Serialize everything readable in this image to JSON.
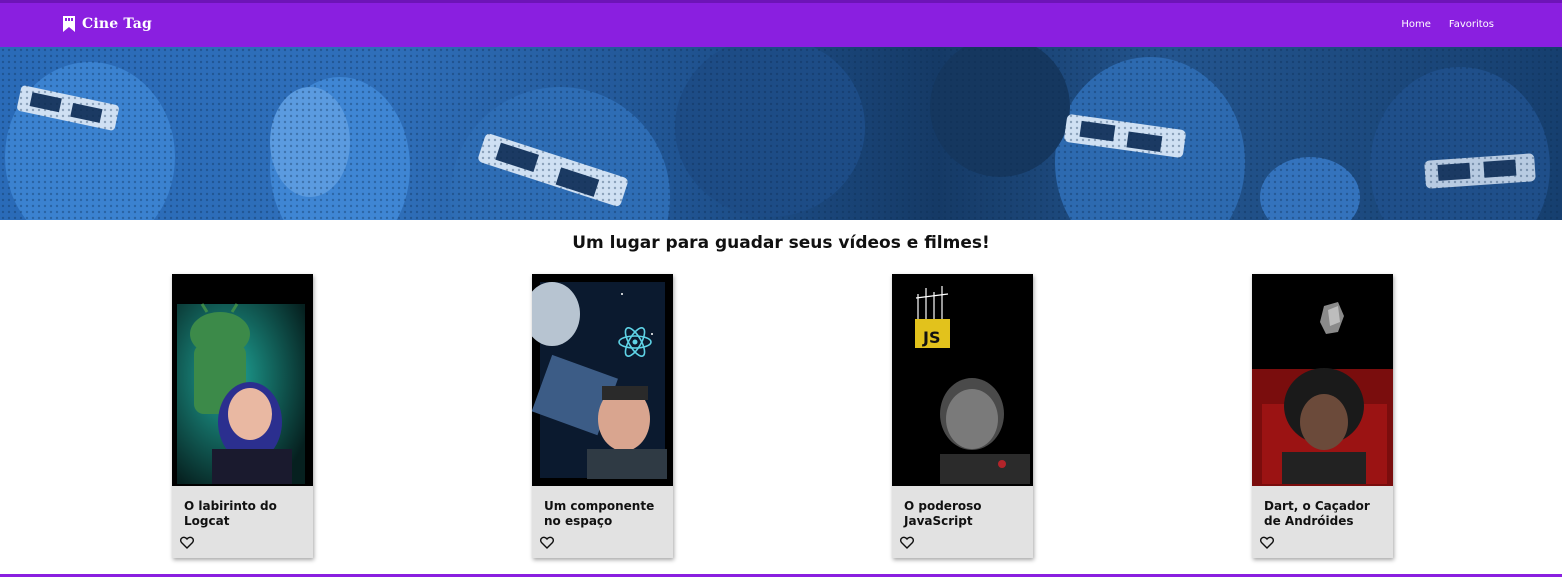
{
  "header": {
    "brand": "Cine Tag",
    "brand_icon": "bookmark-clapper-icon",
    "nav": [
      {
        "label": "Home"
      },
      {
        "label": "Favoritos"
      }
    ]
  },
  "banner": {
    "icon": "cinema-audience-3d-glasses-image"
  },
  "main": {
    "tagline": "Um lugar para guadar seus vídeos e filmes!",
    "cards": [
      {
        "title": "O labirinto do Logcat",
        "favorite_icon": "heart-outline-icon"
      },
      {
        "title": "Um componente no espaço",
        "favorite_icon": "heart-outline-icon"
      },
      {
        "title": "O poderoso JavaScript",
        "favorite_icon": "heart-outline-icon"
      },
      {
        "title": "Dart, o Caçador de Andróides",
        "favorite_icon": "heart-outline-icon"
      }
    ]
  },
  "colors": {
    "header": "#8a1fe0",
    "banner_blue": "#2a6bb8",
    "card_bg": "#e2e2e2"
  }
}
